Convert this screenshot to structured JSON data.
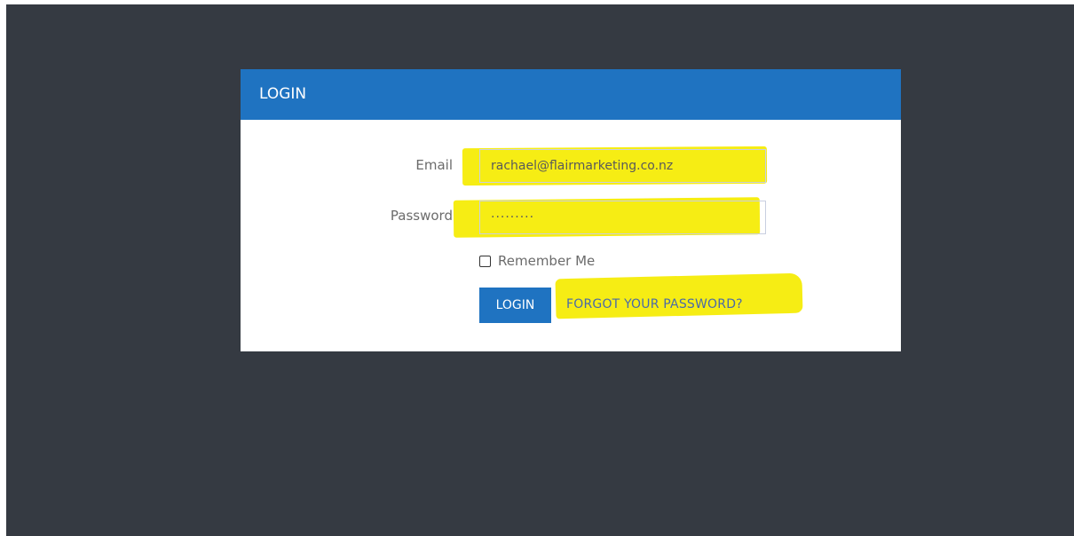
{
  "login_card": {
    "header_title": "LOGIN",
    "email_label": "Email",
    "email_value": "rachael@flairmarketing.co.nz",
    "password_label": "Password",
    "password_value": "·········",
    "remember_label": "Remember Me",
    "remember_checked": false,
    "login_button_label": "LOGIN",
    "forgot_link_label": "FORGOT YOUR PASSWORD?"
  },
  "colors": {
    "background": "#353a42",
    "header": "#1f73c1",
    "highlight": "#f5ec00",
    "link": "#4a6aa8"
  }
}
